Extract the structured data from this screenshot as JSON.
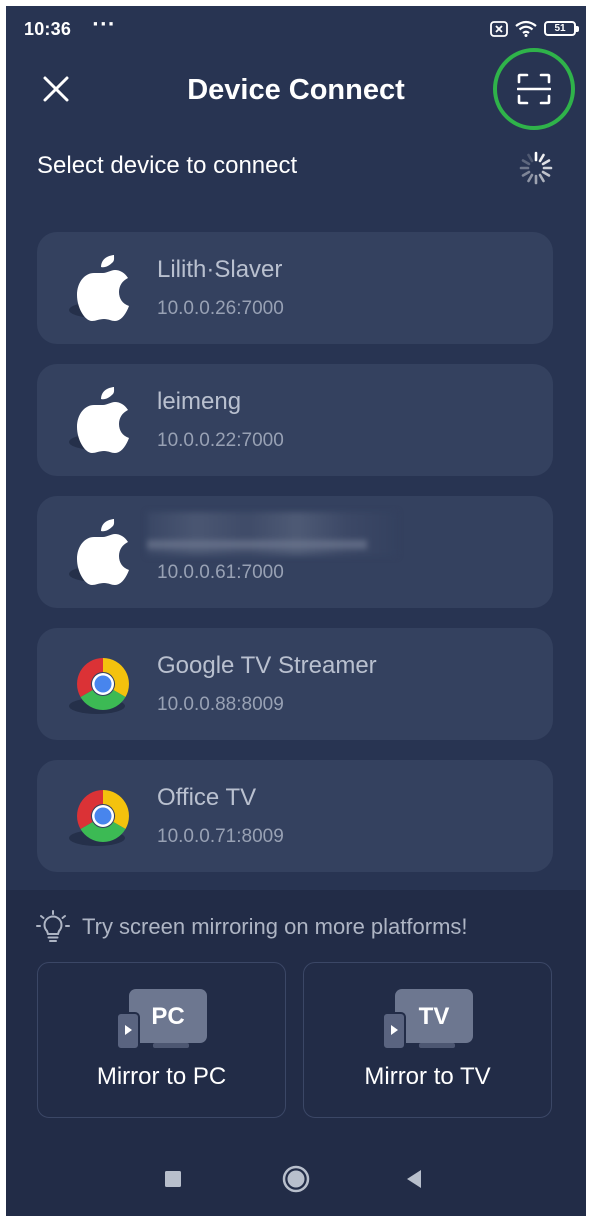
{
  "status_bar": {
    "time": "10:36",
    "more": "···",
    "battery": "51"
  },
  "header": {
    "title": "Device Connect"
  },
  "section": {
    "title": "Select device to connect"
  },
  "devices": [
    {
      "name": "Lilith·Slaver",
      "address": "10.0.0.26:7000",
      "icon": "apple-icon"
    },
    {
      "name": "leimeng",
      "address": "10.0.0.22:7000",
      "icon": "apple-icon"
    },
    {
      "name": "",
      "address": "10.0.0.61:7000",
      "icon": "apple-icon"
    },
    {
      "name": "Google TV Streamer",
      "address": "10.0.0.88:8009",
      "icon": "chrome-icon"
    },
    {
      "name": "Office TV",
      "address": "10.0.0.71:8009",
      "icon": "chrome-icon"
    }
  ],
  "tip": {
    "text": "Try screen mirroring on more platforms!"
  },
  "mirror": {
    "pc": {
      "badge": "PC",
      "label": "Mirror to PC"
    },
    "tv": {
      "badge": "TV",
      "label": "Mirror to TV"
    }
  },
  "colors": {
    "background": "#283452",
    "card": "#34415f",
    "panel": "#222c47",
    "highlight_ring": "#2fb34a"
  }
}
